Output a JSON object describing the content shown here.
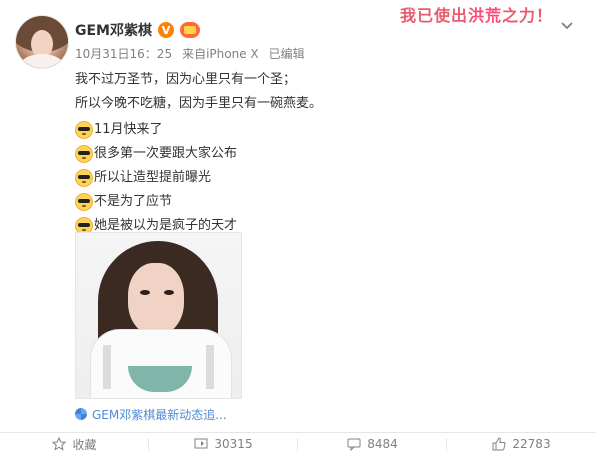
{
  "post": {
    "user_name": "GEM邓紫棋",
    "verified_badge_text": "V",
    "time": "10月31日16：25",
    "source": "来自iPhone X",
    "edited": "已编辑",
    "slogan_prefix": "我已使出",
    "slogan_highlight": "洪荒",
    "slogan_suffix": "之力！",
    "text_lines": [
      "我不过万圣节，因为心里只有一个圣；",
      "所以今晚不吃糖，因为手里只有一碗燕麦。"
    ],
    "emoji_lines": [
      "11月快来了",
      "很多第一次要跟大家公布",
      "所以让造型提前曝光",
      "不是为了应节",
      "她是被以为是疯子的天才"
    ],
    "link_text": "GEM邓紫棋最新动态追...",
    "actions": {
      "favorite_label": "收藏",
      "repost_count": "30315",
      "comment_count": "8484",
      "like_count": "22783"
    }
  },
  "colors": {
    "accent_orange": "#ff8200",
    "link_blue": "#4e8bd7",
    "slogan_pink": "#e85a6e",
    "meta_gray": "#808080"
  },
  "icons": {
    "more": "chevron-down-icon",
    "emoji": "sunglasses-emoji-icon",
    "link": "weibo-topic-icon",
    "favorite": "star-icon",
    "repost": "repost-icon",
    "comment": "comment-icon",
    "like": "thumbs-up-icon"
  }
}
